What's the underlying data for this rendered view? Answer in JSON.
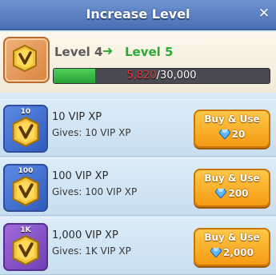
{
  "dialog": {
    "title": "Increase Level",
    "close_icon": "close-icon"
  },
  "level": {
    "current_label": "Level 4",
    "next_label": "Level 5",
    "arrow_icon": "arrow-right-icon",
    "progress_current": "5,820",
    "progress_max": "/30,000",
    "progress_fraction": 0.194,
    "icon": "vip-token-icon"
  },
  "items": [
    {
      "badge": "10",
      "name": "10 VIP XP",
      "gives": "Gives: 10 VIP XP",
      "button_label": "Buy & Use",
      "price": "20",
      "icon_color": "blue"
    },
    {
      "badge": "100",
      "name": "100 VIP XP",
      "gives": "Gives: 100 VIP XP",
      "button_label": "Buy & Use",
      "price": "200",
      "icon_color": "blue"
    },
    {
      "badge": "1K",
      "name": "1,000 VIP XP",
      "gives": "Gives: 1K VIP XP",
      "button_label": "Buy & Use",
      "price": "2,000",
      "icon_color": "purple"
    }
  ],
  "colors": {
    "header": "#4a71b6",
    "progress_fill": "#26a133",
    "progress_current_text": "#e23a3a",
    "button": "#f59a12",
    "level_next": "#2fa83a"
  }
}
